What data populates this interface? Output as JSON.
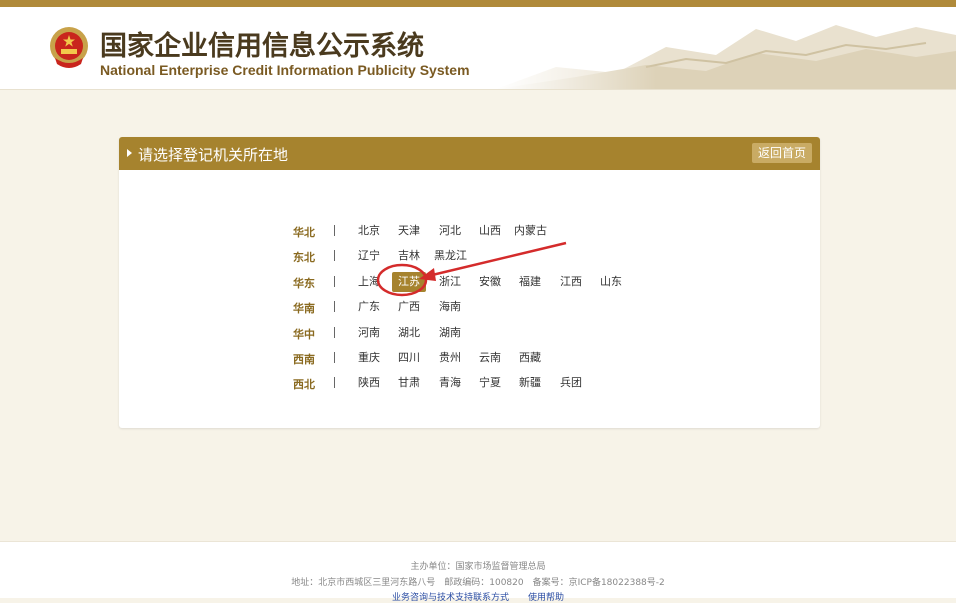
{
  "header": {
    "title": "国家企业信用信息公示系统",
    "subtitle": "National Enterprise Credit Information Publicity System"
  },
  "panel": {
    "title": "请选择登记机关所在地",
    "home_button": "返回首页"
  },
  "regions": [
    {
      "name": "华北",
      "provinces": [
        "北京",
        "天津",
        "河北",
        "山西",
        "内蒙古"
      ]
    },
    {
      "name": "东北",
      "provinces": [
        "辽宁",
        "吉林",
        "黑龙江"
      ]
    },
    {
      "name": "华东",
      "provinces": [
        "上海",
        "江苏",
        "浙江",
        "安徽",
        "福建",
        "江西",
        "山东"
      ]
    },
    {
      "name": "华南",
      "provinces": [
        "广东",
        "广西",
        "海南"
      ]
    },
    {
      "name": "华中",
      "provinces": [
        "河南",
        "湖北",
        "湖南"
      ]
    },
    {
      "name": "西南",
      "provinces": [
        "重庆",
        "四川",
        "贵州",
        "云南",
        "西藏"
      ]
    },
    {
      "name": "西北",
      "provinces": [
        "陕西",
        "甘肃",
        "青海",
        "宁夏",
        "新疆",
        "兵团"
      ]
    }
  ],
  "selected_province": "江苏",
  "footer": {
    "sponsor": "主办单位：国家市场监督管理总局",
    "address": "地址：北京市西城区三里河东路八号　邮政编码：100820　备案号：京ICP备18022388号-2",
    "links": [
      "业务咨询与技术支持联系方式",
      "使用帮助"
    ]
  },
  "colors": {
    "accent": "#a6832e",
    "annotation": "#d42b2b"
  }
}
